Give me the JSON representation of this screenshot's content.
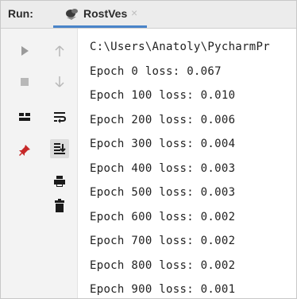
{
  "header": {
    "run_label": "Run:",
    "tab_label": "RostVes",
    "tab_close": "×"
  },
  "toolbar": {
    "left_column": [
      {
        "name": "run-icon",
        "enabled": true
      },
      {
        "name": "stop-icon",
        "enabled": false
      },
      {
        "name": "layout-icon",
        "enabled": true
      },
      {
        "name": "pin-icon",
        "enabled": true
      }
    ],
    "right_column": [
      {
        "name": "arrow-up-icon",
        "enabled": false
      },
      {
        "name": "arrow-down-icon",
        "enabled": false
      },
      {
        "name": "soft-wrap-icon",
        "enabled": true
      },
      {
        "name": "scroll-to-end-icon",
        "enabled": true,
        "active": true
      },
      {
        "name": "print-icon",
        "enabled": true
      },
      {
        "name": "trash-icon",
        "enabled": true
      }
    ]
  },
  "console": {
    "lines": [
      "C:\\Users\\Anatoly\\PycharmPr",
      "Epoch 0 loss: 0.067",
      "Epoch 100 loss: 0.010",
      "Epoch 200 loss: 0.006",
      "Epoch 300 loss: 0.004",
      "Epoch 400 loss: 0.003",
      "Epoch 500 loss: 0.003",
      "Epoch 600 loss: 0.002",
      "Epoch 700 loss: 0.002",
      "Epoch 800 loss: 0.002",
      "Epoch 900 loss: 0.001"
    ]
  },
  "colors": {
    "tab_underline": "#4a84c9",
    "icon_dark": "#1a1a1a",
    "icon_disabled": "#b8b8b8",
    "run_icon_disabled": "#9a9a9a",
    "pin_red": "#c62828"
  }
}
